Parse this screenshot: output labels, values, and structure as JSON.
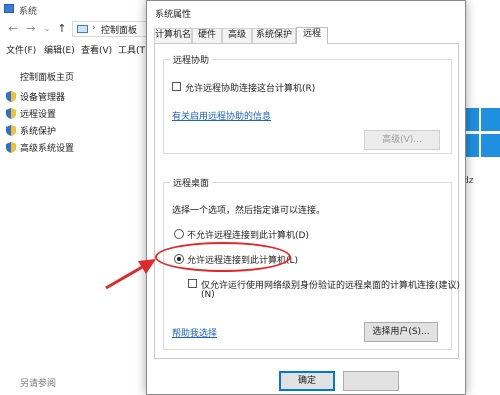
{
  "background_window": {
    "title": "系统",
    "nav": {
      "back_icon": "back-arrow-icon",
      "forward_icon": "forward-arrow-icon",
      "recent_icon": "chevron-down-icon",
      "up_icon": "up-arrow-icon"
    },
    "address": {
      "separator": "›",
      "crumb": "控制面板"
    },
    "menu": [
      "文件(F)",
      "编辑(E)",
      "查看(V)",
      "工具(T)"
    ],
    "sidebar": {
      "home": "控制面板主页",
      "links": [
        {
          "label": "设备管理器",
          "icon": "shield-icon"
        },
        {
          "label": "远程设置",
          "icon": "shield-icon"
        },
        {
          "label": "系统保护",
          "icon": "shield-icon"
        },
        {
          "label": "高级系统设置",
          "icon": "shield-icon"
        }
      ],
      "see_also": "另请参阅"
    },
    "right_fragment": "dz"
  },
  "dialog": {
    "title": "系统属性",
    "tabs": [
      "计算机名",
      "硬件",
      "高级",
      "系统保护",
      "远程"
    ],
    "active_tab": "远程",
    "remote_assistance": {
      "legend": "远程协助",
      "allow_checkbox_label": "允许远程协助连接这台计算机(R)",
      "allow_checked": false,
      "info_link": "有关启用远程协助的信息",
      "advanced_button": "高级(V)..."
    },
    "remote_desktop": {
      "legend": "远程桌面",
      "instruction": "选择一个选项，然后指定谁可以连接。",
      "option_deny": "不允许远程连接到此计算机(D)",
      "option_allow": "允许远程连接到此计算机(L)",
      "selected": "allow",
      "nla_label_line1": "仅允许运行使用网络级别身份验证的远程桌面的计算机连接(建议)",
      "nla_label_line2": "(N)",
      "nla_checked": false,
      "help_link": "帮助我选择",
      "select_users_button": "选择用户(S)..."
    },
    "footer": {
      "ok_button": "确定"
    }
  },
  "colors": {
    "annotation_red": "#e02a2a",
    "link_blue": "#1a62c4",
    "win_blue": "#1f8fe0"
  }
}
